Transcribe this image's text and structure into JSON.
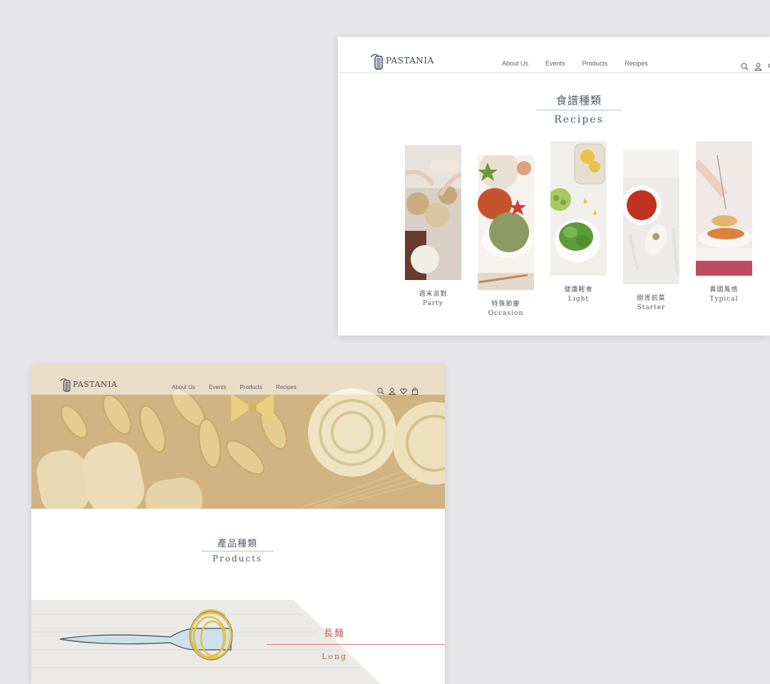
{
  "recipes_page": {
    "brand": "PASTANIA",
    "nav": [
      "About Us",
      "Events",
      "Products",
      "Recipes"
    ],
    "icons": [
      "search-icon",
      "user-icon",
      "heart-icon"
    ],
    "section": {
      "title_cn": "食譜種類",
      "title_en": "Recipes"
    },
    "categories": [
      {
        "cn": "週末派對",
        "en": "Party"
      },
      {
        "cn": "特殊節慶",
        "en": "Occasion"
      },
      {
        "cn": "健康輕食",
        "en": "Light"
      },
      {
        "cn": "開胃前菜",
        "en": "Starter"
      },
      {
        "cn": "異國風情",
        "en": "Typical"
      }
    ]
  },
  "products_page": {
    "brand": "PASTANIA",
    "nav": [
      "About Us",
      "Events",
      "Products",
      "Recipes"
    ],
    "icons": [
      "search-icon",
      "user-icon",
      "heart-icon",
      "bag-icon"
    ],
    "section": {
      "title_cn": "產品種類",
      "title_en": "Products"
    },
    "category_banner": {
      "cn": "長麵",
      "en": "Long"
    }
  },
  "colors": {
    "background": "#e6e6e8",
    "text_dark": "#4e5e6a",
    "accent_red": "#c0584e"
  }
}
